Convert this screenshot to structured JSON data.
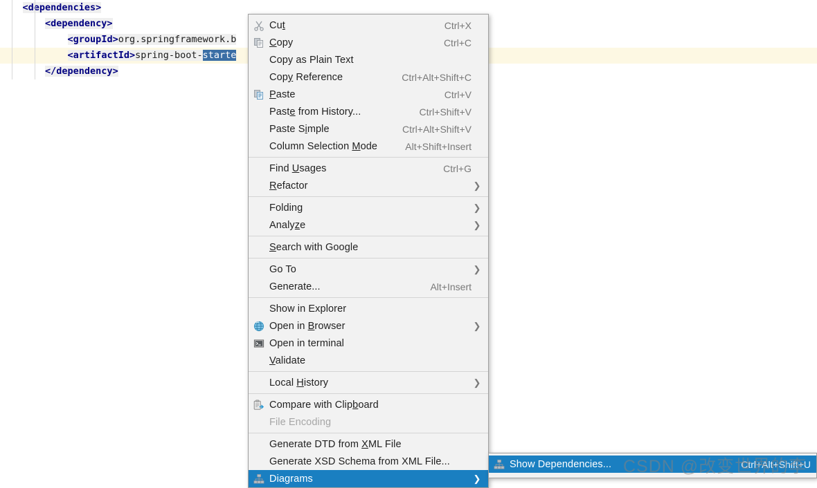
{
  "editor": {
    "lines": [
      {
        "indent": 0,
        "segments": [
          {
            "type": "tag",
            "text": "<dependencies>"
          }
        ],
        "current": false
      },
      {
        "indent": 1,
        "segments": [
          {
            "type": "tag",
            "text": "<dependency>"
          }
        ],
        "current": false
      },
      {
        "indent": 2,
        "segments": [
          {
            "type": "tag",
            "text": "<groupId>"
          },
          {
            "type": "text",
            "text": "org.springframework.b"
          }
        ],
        "current": false
      },
      {
        "indent": 2,
        "segments": [
          {
            "type": "tag",
            "text": "<artifactId>"
          },
          {
            "type": "text",
            "text": "spring-boot-"
          },
          {
            "type": "sel",
            "text": "starte"
          }
        ],
        "current": true
      },
      {
        "indent": 1,
        "segments": [
          {
            "type": "tag",
            "text": "</dependency>"
          }
        ],
        "current": false
      }
    ]
  },
  "context_menu": {
    "groups": [
      {
        "items": [
          {
            "icon": "cut-icon",
            "label": "Cut",
            "mnemonic": "t",
            "shortcut": "Ctrl+X",
            "arrow": false,
            "disabled": false,
            "selected": false
          },
          {
            "icon": "copy-icon",
            "label": "Copy",
            "mnemonic": "C",
            "shortcut": "Ctrl+C",
            "arrow": false,
            "disabled": false,
            "selected": false
          },
          {
            "icon": "",
            "label": "Copy as Plain Text",
            "mnemonic": "",
            "shortcut": "",
            "arrow": false,
            "disabled": false,
            "selected": false
          },
          {
            "icon": "",
            "label": "Copy Reference",
            "mnemonic": "y",
            "shortcut": "Ctrl+Alt+Shift+C",
            "arrow": false,
            "disabled": false,
            "selected": false
          },
          {
            "icon": "paste-icon",
            "label": "Paste",
            "mnemonic": "P",
            "shortcut": "Ctrl+V",
            "arrow": false,
            "disabled": false,
            "selected": false
          },
          {
            "icon": "",
            "label": "Paste from History...",
            "mnemonic": "e",
            "shortcut": "Ctrl+Shift+V",
            "arrow": false,
            "disabled": false,
            "selected": false
          },
          {
            "icon": "",
            "label": "Paste Simple",
            "mnemonic": "i",
            "shortcut": "Ctrl+Alt+Shift+V",
            "arrow": false,
            "disabled": false,
            "selected": false
          },
          {
            "icon": "",
            "label": "Column Selection Mode",
            "mnemonic": "M",
            "shortcut": "Alt+Shift+Insert",
            "arrow": false,
            "disabled": false,
            "selected": false
          }
        ]
      },
      {
        "items": [
          {
            "icon": "",
            "label": "Find Usages",
            "mnemonic": "U",
            "shortcut": "Ctrl+G",
            "arrow": false,
            "disabled": false,
            "selected": false
          },
          {
            "icon": "",
            "label": "Refactor",
            "mnemonic": "R",
            "shortcut": "",
            "arrow": true,
            "disabled": false,
            "selected": false
          }
        ]
      },
      {
        "items": [
          {
            "icon": "",
            "label": "Folding",
            "mnemonic": "",
            "shortcut": "",
            "arrow": true,
            "disabled": false,
            "selected": false
          },
          {
            "icon": "",
            "label": "Analyze",
            "mnemonic": "z",
            "shortcut": "",
            "arrow": true,
            "disabled": false,
            "selected": false
          }
        ]
      },
      {
        "items": [
          {
            "icon": "",
            "label": "Search with Google",
            "mnemonic": "S",
            "shortcut": "",
            "arrow": false,
            "disabled": false,
            "selected": false
          }
        ]
      },
      {
        "items": [
          {
            "icon": "",
            "label": "Go To",
            "mnemonic": "",
            "shortcut": "",
            "arrow": true,
            "disabled": false,
            "selected": false
          },
          {
            "icon": "",
            "label": "Generate...",
            "mnemonic": "",
            "shortcut": "Alt+Insert",
            "arrow": false,
            "disabled": false,
            "selected": false
          }
        ]
      },
      {
        "items": [
          {
            "icon": "",
            "label": "Show in Explorer",
            "mnemonic": "",
            "shortcut": "",
            "arrow": false,
            "disabled": false,
            "selected": false
          },
          {
            "icon": "globe-icon",
            "label": "Open in Browser",
            "mnemonic": "B",
            "shortcut": "",
            "arrow": true,
            "disabled": false,
            "selected": false
          },
          {
            "icon": "terminal-icon",
            "label": "Open in terminal",
            "mnemonic": "",
            "shortcut": "",
            "arrow": false,
            "disabled": false,
            "selected": false
          },
          {
            "icon": "",
            "label": "Validate",
            "mnemonic": "V",
            "shortcut": "",
            "arrow": false,
            "disabled": false,
            "selected": false
          }
        ]
      },
      {
        "items": [
          {
            "icon": "",
            "label": "Local History",
            "mnemonic": "H",
            "shortcut": "",
            "arrow": true,
            "disabled": false,
            "selected": false
          }
        ]
      },
      {
        "items": [
          {
            "icon": "compare-clipboard-icon",
            "label": "Compare with Clipboard",
            "mnemonic": "b",
            "shortcut": "",
            "arrow": false,
            "disabled": false,
            "selected": false
          },
          {
            "icon": "",
            "label": "File Encoding",
            "mnemonic": "",
            "shortcut": "",
            "arrow": false,
            "disabled": true,
            "selected": false
          }
        ]
      },
      {
        "items": [
          {
            "icon": "",
            "label": "Generate DTD from XML File",
            "mnemonic": "X",
            "shortcut": "",
            "arrow": false,
            "disabled": false,
            "selected": false
          },
          {
            "icon": "",
            "label": "Generate XSD Schema from XML File...",
            "mnemonic": "",
            "shortcut": "",
            "arrow": false,
            "disabled": false,
            "selected": false
          },
          {
            "icon": "diagram-icon",
            "label": "Diagrams",
            "mnemonic": "",
            "shortcut": "",
            "arrow": true,
            "disabled": false,
            "selected": true
          }
        ]
      }
    ]
  },
  "submenu": {
    "items": [
      {
        "icon": "diagram-icon",
        "label": "Show Dependencies...",
        "shortcut": "Ctrl+Alt+Shift+U",
        "selected": true
      }
    ]
  },
  "watermark": {
    "text": "CSDN @改变世界的李"
  },
  "colors": {
    "menu_bg": "#f2f2f2",
    "menu_border": "#a0a0a0",
    "selection_blue": "#1a7fc1",
    "editor_selection": "#3a6ea5",
    "current_line": "#fdf8e3",
    "xml_tag": "#000080",
    "shortcut_grey": "#787878",
    "disabled_grey": "#a6a6a6"
  }
}
